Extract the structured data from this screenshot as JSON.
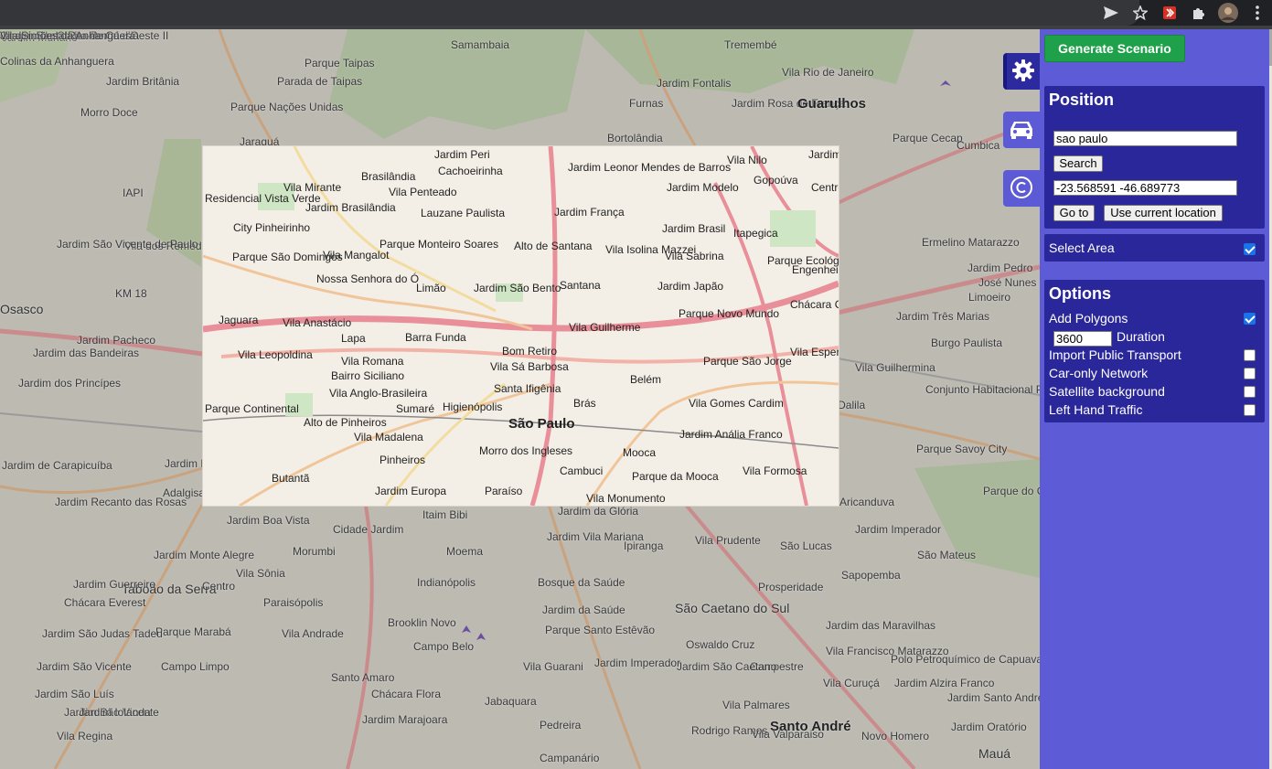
{
  "browser": {
    "icons": [
      "send-icon",
      "star-icon",
      "extension-red-icon",
      "puzzle-icon",
      "profile-avatar",
      "kebab-menu-icon"
    ]
  },
  "map": {
    "labels_outside": [
      {
        "text": "Jardim Muriano",
        "cls": ""
      },
      {
        "text": "Colinas da Anhanguera",
        "cls": ""
      },
      {
        "text": "Jardim Britânia",
        "cls": ""
      },
      {
        "text": "Morro Doce",
        "cls": ""
      },
      {
        "text": "Parque Nações Unidas",
        "cls": ""
      },
      {
        "text": "Parque Taipas",
        "cls": ""
      },
      {
        "text": "Parada de Taipas",
        "cls": ""
      },
      {
        "text": "Jaraguá",
        "cls": ""
      },
      {
        "text": "Samambaia",
        "cls": ""
      },
      {
        "text": "Tremembé",
        "cls": ""
      },
      {
        "text": "Jardim Fontalis",
        "cls": ""
      },
      {
        "text": "Furnas",
        "cls": ""
      },
      {
        "text": "Jardim Rosa de França",
        "cls": ""
      },
      {
        "text": "Bortolândia",
        "cls": ""
      },
      {
        "text": "Vila Rio de Janeiro",
        "cls": ""
      },
      {
        "text": "Guarulhos",
        "cls": "city"
      },
      {
        "text": "Parque Cecap",
        "cls": ""
      },
      {
        "text": "Cumbica",
        "cls": ""
      },
      {
        "text": "Ermelino Matarazzo",
        "cls": ""
      },
      {
        "text": "Jardim Pedro",
        "cls": ""
      },
      {
        "text": "José Nunes",
        "cls": ""
      },
      {
        "text": "Limoeiro",
        "cls": ""
      },
      {
        "text": "Jardim Três Marias",
        "cls": ""
      },
      {
        "text": "Burgo Paulista",
        "cls": ""
      },
      {
        "text": "Vila Guilhermina",
        "cls": ""
      },
      {
        "text": "Conjunto Habitacional Padre Manoel da Nóbrega",
        "cls": ""
      },
      {
        "text": "Vila Dalila",
        "cls": ""
      },
      {
        "text": "Parque Savoy City",
        "cls": ""
      },
      {
        "text": "Aricanduva",
        "cls": ""
      },
      {
        "text": "Parque do Carmo",
        "cls": ""
      },
      {
        "text": "Jardim Imperador",
        "cls": ""
      },
      {
        "text": "São Mateus",
        "cls": ""
      },
      {
        "text": "São Lucas",
        "cls": ""
      },
      {
        "text": "Sapopemba",
        "cls": ""
      },
      {
        "text": "Vila Prudente",
        "cls": ""
      },
      {
        "text": "Jardim da Glória",
        "cls": ""
      },
      {
        "text": "Jardim Vila Mariana",
        "cls": ""
      },
      {
        "text": "Ipiranga",
        "cls": ""
      },
      {
        "text": "Moema",
        "cls": ""
      },
      {
        "text": "Itaim Bibi",
        "cls": ""
      },
      {
        "text": "Cidade Jardim",
        "cls": ""
      },
      {
        "text": "Morumbi",
        "cls": ""
      },
      {
        "text": "Vila Sônia",
        "cls": ""
      },
      {
        "text": "Jardim Boa Vista",
        "cls": ""
      },
      {
        "text": "Jardim Monte Alegre",
        "cls": ""
      },
      {
        "text": "Taboão da Serra",
        "cls": "big"
      },
      {
        "text": "Centro",
        "cls": ""
      },
      {
        "text": "Paraisópolis",
        "cls": ""
      },
      {
        "text": "Indianópolis",
        "cls": ""
      },
      {
        "text": "Bosque da Saúde",
        "cls": ""
      },
      {
        "text": "Jardim da Saúde",
        "cls": ""
      },
      {
        "text": "Prosperidade",
        "cls": ""
      },
      {
        "text": "São Caetano do Sul",
        "cls": "big"
      },
      {
        "text": "Parque Santo Estêvão",
        "cls": ""
      },
      {
        "text": "Brooklin Novo",
        "cls": ""
      },
      {
        "text": "Campo Belo",
        "cls": ""
      },
      {
        "text": "Vila Guarani",
        "cls": ""
      },
      {
        "text": "Oswaldo Cruz",
        "cls": ""
      },
      {
        "text": "Campestre",
        "cls": ""
      },
      {
        "text": "Jardim das Maravilhas",
        "cls": ""
      },
      {
        "text": "Vila Francisco Matarazzo",
        "cls": ""
      },
      {
        "text": "Polo Petroquímico de Capuava",
        "cls": ""
      },
      {
        "text": "Jardim São Caetano",
        "cls": ""
      },
      {
        "text": "Jardim Imperador",
        "cls": ""
      },
      {
        "text": "Vila Curuçá",
        "cls": ""
      },
      {
        "text": "Jardim Alzira Franco",
        "cls": ""
      },
      {
        "text": "Jardim Santo André",
        "cls": ""
      },
      {
        "text": "Santo Amaro",
        "cls": ""
      },
      {
        "text": "Chácara Flora",
        "cls": ""
      },
      {
        "text": "Jabaquara",
        "cls": ""
      },
      {
        "text": "Vila Palmares",
        "cls": ""
      },
      {
        "text": "Santo André",
        "cls": "city"
      },
      {
        "text": "Jardim Marajoara",
        "cls": ""
      },
      {
        "text": "Pedreira",
        "cls": ""
      },
      {
        "text": "Rodrigo Ramos",
        "cls": ""
      },
      {
        "text": "Novo Homero",
        "cls": ""
      },
      {
        "text": "Jardim Oratório",
        "cls": ""
      },
      {
        "text": "Campanário",
        "cls": ""
      },
      {
        "text": "Vila Valparaiso",
        "cls": ""
      },
      {
        "text": "Mauá",
        "cls": "big"
      },
      {
        "text": "Vila Andrade",
        "cls": ""
      },
      {
        "text": "Campo Limpo",
        "cls": ""
      },
      {
        "text": "Parque Marabá",
        "cls": ""
      },
      {
        "text": "Jardim São Judas Tadeu",
        "cls": ""
      },
      {
        "text": "Jardim São Vicente",
        "cls": ""
      },
      {
        "text": "Jardim São Luís",
        "cls": ""
      },
      {
        "text": "Jardim São Vicente",
        "cls": ""
      },
      {
        "text": "Vila Regina",
        "cls": ""
      },
      {
        "text": "Jardim Iolanda",
        "cls": ""
      },
      {
        "text": "Chácara Everest",
        "cls": ""
      },
      {
        "text": "Jardim Guerreiro",
        "cls": ""
      },
      {
        "text": "Jardim Recanto das Rosas",
        "cls": ""
      },
      {
        "text": "Jardim de Carapicuíba",
        "cls": ""
      },
      {
        "text": "Jardim D'Abril",
        "cls": ""
      },
      {
        "text": "Adalgisa",
        "cls": ""
      },
      {
        "text": "Jardim dos Princípes",
        "cls": ""
      },
      {
        "text": "Jardim Pacheco",
        "cls": ""
      },
      {
        "text": "Jardim das Bandeiras",
        "cls": ""
      },
      {
        "text": "Osasco",
        "cls": "big"
      },
      {
        "text": "KM 18",
        "cls": ""
      },
      {
        "text": "Vila dos Remédios",
        "cls": ""
      },
      {
        "text": "Jardim São Vicente de Paulo",
        "cls": ""
      },
      {
        "text": "IAPI",
        "cls": ""
      },
      {
        "text": "Jardim Rochdale",
        "cls": ""
      },
      {
        "text": "Chapéu de Couro-Portal d'Oeste II",
        "cls": ""
      },
      {
        "text": "Jardim Santa Rita de Cássia",
        "cls": ""
      },
      {
        "text": "Vila Simões da Anhanguera",
        "cls": ""
      }
    ],
    "labels_inside": [
      {
        "text": "Jardim Peri"
      },
      {
        "text": "Cachoeirinha"
      },
      {
        "text": "Jardim Leonor Mendes de Barros"
      },
      {
        "text": "Vila Nilo"
      },
      {
        "text": "Jardim Paraventi"
      },
      {
        "text": "Gopoúva"
      },
      {
        "text": "Jardim Modelo"
      },
      {
        "text": "Centro"
      },
      {
        "text": "Vila Mirante"
      },
      {
        "text": "Brasilândia"
      },
      {
        "text": "Vila Penteado"
      },
      {
        "text": "Lauzane Paulista"
      },
      {
        "text": "Jardim França"
      },
      {
        "text": "Jardim Brasil"
      },
      {
        "text": "Itapegica"
      },
      {
        "text": "Residencial Vista Verde"
      },
      {
        "text": "Jardim Brasilândia"
      },
      {
        "text": "City Pinheirinho"
      },
      {
        "text": "Parque Monteiro Soares"
      },
      {
        "text": "Alto de Santana"
      },
      {
        "text": "Vila Isolina Mazzei"
      },
      {
        "text": "Vila Sabrina"
      },
      {
        "text": "Parque São Domingos"
      },
      {
        "text": "Vila Mangalot"
      },
      {
        "text": "Nossa Senhora do Ó"
      },
      {
        "text": "Limão"
      },
      {
        "text": "Jardim São Bento"
      },
      {
        "text": "Santana"
      },
      {
        "text": "Jardim Japão"
      },
      {
        "text": "Parque Ecológico do Tietê"
      },
      {
        "text": "Engenheiro Goulart"
      },
      {
        "text": "Chácara Cruzeiro do Sul"
      },
      {
        "text": "Parque Novo Mundo"
      },
      {
        "text": "Jaguara"
      },
      {
        "text": "Vila Anastácio"
      },
      {
        "text": "Barra Funda"
      },
      {
        "text": "Vila Guilherme"
      },
      {
        "text": "Lapa"
      },
      {
        "text": "Bom Retiro"
      },
      {
        "text": "Vila Leopoldina"
      },
      {
        "text": "Vila Romana"
      },
      {
        "text": "Vila Sá Barbosa"
      },
      {
        "text": "Parque São Jorge"
      },
      {
        "text": "Vila Esperança"
      },
      {
        "text": "Bairro Siciliano"
      },
      {
        "text": "Belém"
      },
      {
        "text": "Vila Anglo-Brasileira"
      },
      {
        "text": "Santa Ifigênia"
      },
      {
        "text": "Parque Continental"
      },
      {
        "text": "Sumaré"
      },
      {
        "text": "Higienópolis"
      },
      {
        "text": "Brás"
      },
      {
        "text": "Vila Gomes Cardim"
      },
      {
        "text": "Alto de Pinheiros"
      },
      {
        "text": "São Paulo"
      },
      {
        "text": "Vila Madalena"
      },
      {
        "text": "Jardim Anália Franco"
      },
      {
        "text": "Pinheiros"
      },
      {
        "text": "Morro dos Ingleses"
      },
      {
        "text": "Mooca"
      },
      {
        "text": "Butantã"
      },
      {
        "text": "Cambuci"
      },
      {
        "text": "Parque da Mooca"
      },
      {
        "text": "Vila Formosa"
      },
      {
        "text": "Jardim Europa"
      },
      {
        "text": "Paraíso"
      },
      {
        "text": "Vila Monumento"
      }
    ]
  },
  "side_tabs": [
    {
      "name": "settings-tab",
      "icon": "gear-icon"
    },
    {
      "name": "vehicle-tab",
      "icon": "car-icon"
    },
    {
      "name": "credits-tab",
      "icon": "copyright-icon"
    }
  ],
  "panel": {
    "generate_label": "Generate Scenario",
    "position": {
      "title": "Position",
      "search_value": "sao paulo",
      "search_button": "Search",
      "coords_value": "-23.568591 -46.689773",
      "goto_button": "Go to",
      "current_location_button": "Use current location"
    },
    "select_area": {
      "label": "Select Area",
      "checked": true
    },
    "options": {
      "title": "Options",
      "add_polygons": {
        "label": "Add Polygons",
        "checked": true
      },
      "duration_value": "3600",
      "duration_label": "Duration",
      "import_public_transport": {
        "label": "Import Public Transport",
        "checked": false
      },
      "car_only": {
        "label": "Car-only Network",
        "checked": false
      },
      "satellite": {
        "label": "Satellite background",
        "checked": false
      },
      "left_hand": {
        "label": "Left Hand Traffic",
        "checked": false
      }
    }
  },
  "colors": {
    "panel_bg": "#5e5bd6",
    "box_bg": "#2a279a",
    "generate_btn": "#1ea14a"
  }
}
